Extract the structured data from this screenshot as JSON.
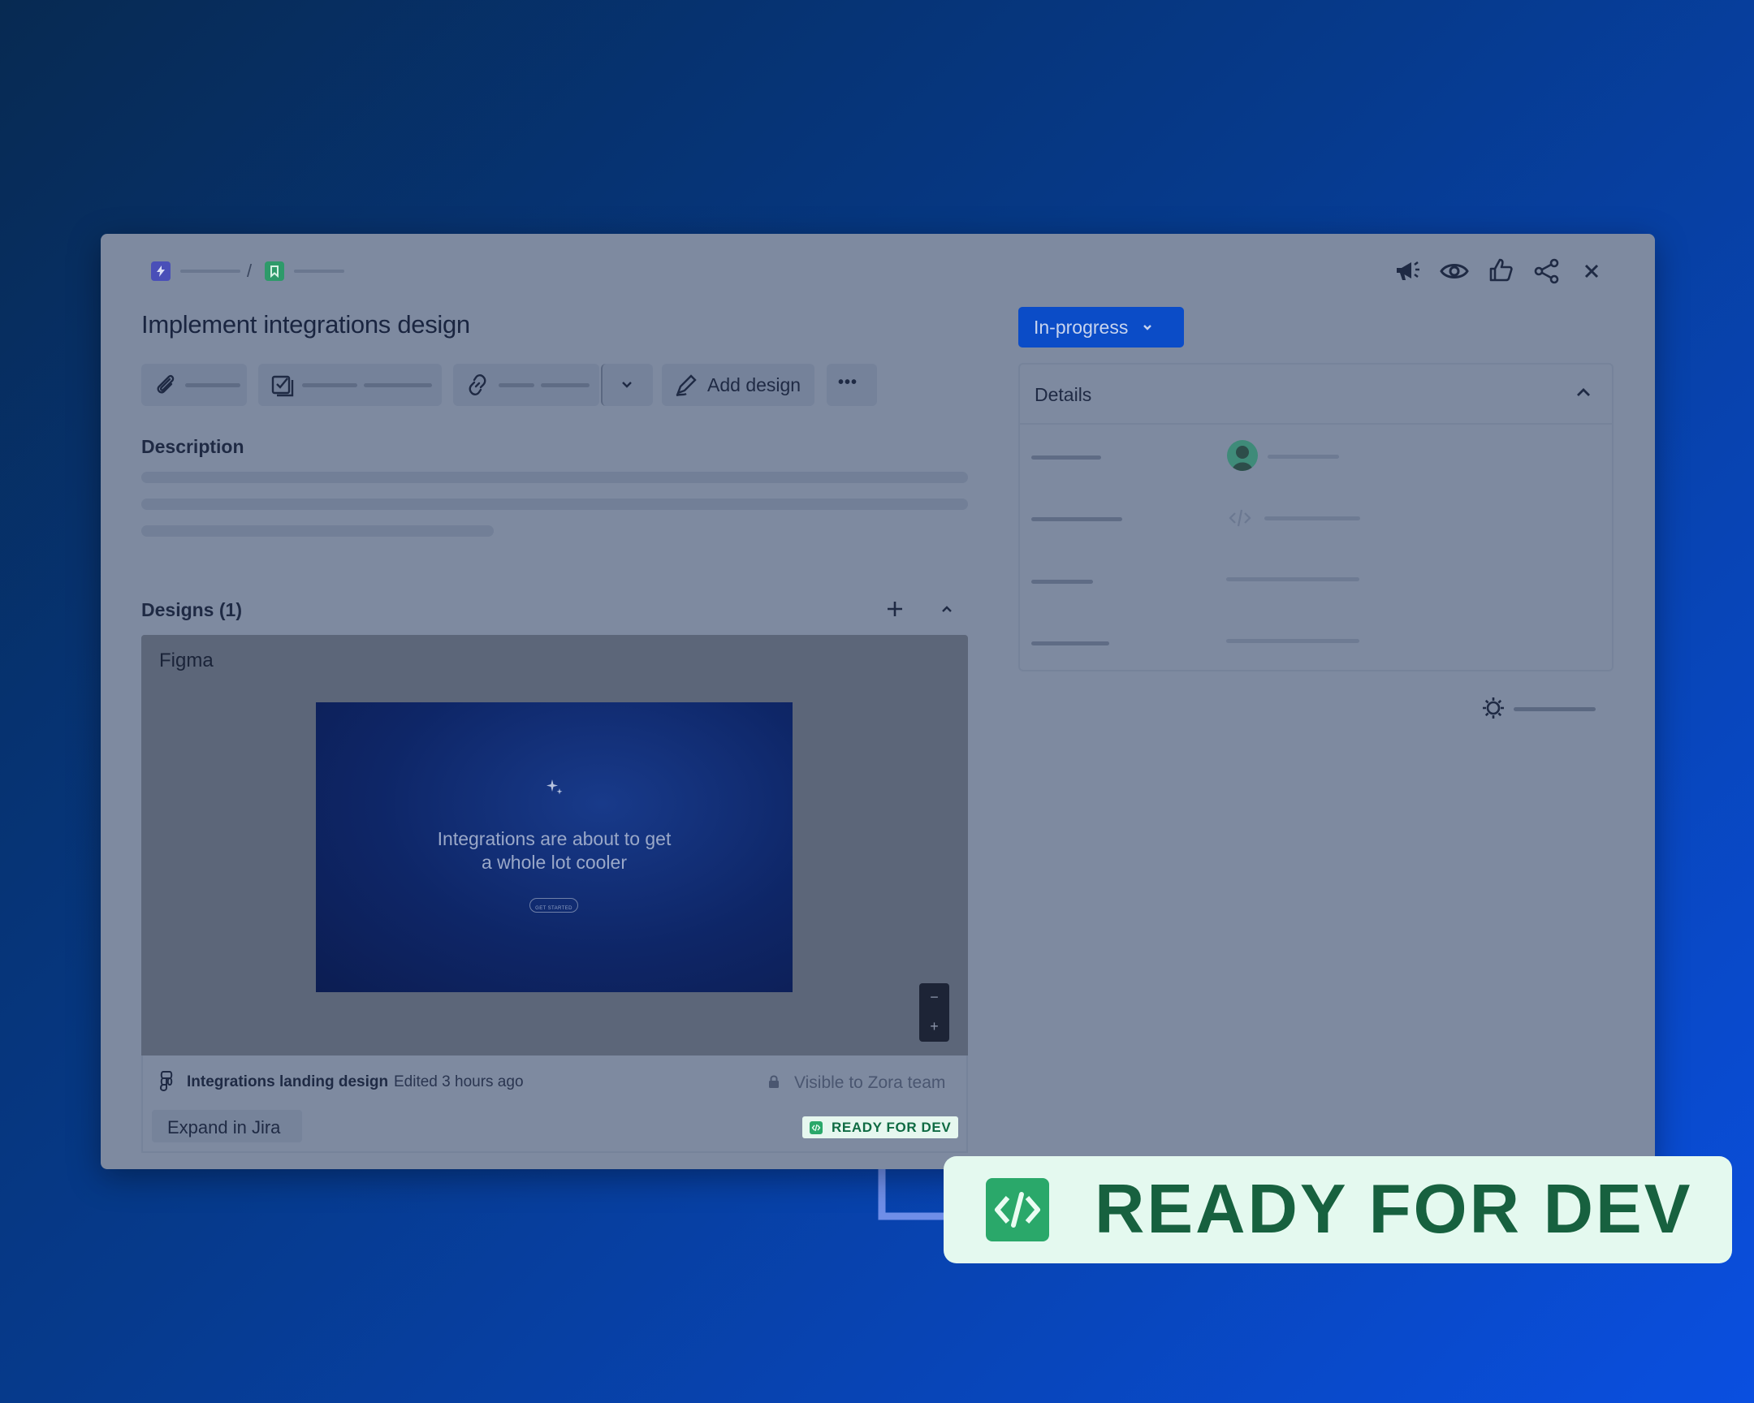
{
  "issue": {
    "title": "Implement integrations design"
  },
  "breadcrumb": {
    "separator": "/"
  },
  "toolbar": {
    "add_design_label": "Add design",
    "more_label": "•••"
  },
  "description": {
    "heading": "Description"
  },
  "designs": {
    "heading": "Designs (1)",
    "source_label": "Figma",
    "preview_text_line1": "Integrations are about to get",
    "preview_text_line2": "a whole lot cooler",
    "preview_button_label": "GET STARTED",
    "zoom_out": "−",
    "zoom_in": "+",
    "file_name": "Integrations landing design",
    "edited": "Edited 3 hours ago",
    "visibility": "Visible to Zora team",
    "expand_label": "Expand in Jira",
    "status_badge": "READY FOR DEV"
  },
  "status": {
    "label": "In-progress"
  },
  "details": {
    "heading": "Details"
  },
  "callout": {
    "label": "READY FOR DEV"
  },
  "colors": {
    "accent_blue": "#0b4cc7",
    "ready_green": "#17613f",
    "ready_bg": "#e4f9ef",
    "connector": "#6f8ee8"
  },
  "icons": {
    "epic": "lightning-icon",
    "story": "bookmark-icon",
    "announce": "megaphone-icon",
    "watch": "eye-icon",
    "like": "thumbs-up-icon",
    "share": "share-icon",
    "close": "close-icon",
    "attach": "paperclip-icon",
    "checklist": "checkbox-icon",
    "link": "link-icon",
    "design": "pen-icon",
    "figma": "figma-icon",
    "lock": "lock-icon",
    "settings": "gear-icon",
    "code": "code-icon"
  }
}
